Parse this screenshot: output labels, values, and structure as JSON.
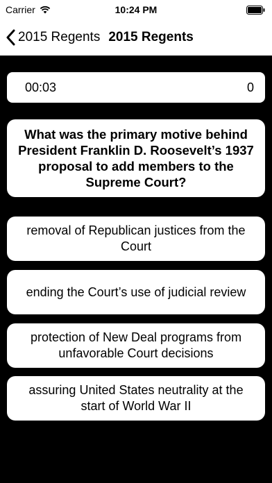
{
  "status_bar": {
    "carrier": "Carrier",
    "time": "10:24 PM"
  },
  "nav": {
    "back_label": "2015 Regents",
    "title": "2015 Regents"
  },
  "timer": {
    "elapsed": "00:03",
    "score": "0"
  },
  "question": {
    "text": "What was the primary motive behind President Franklin D. Roosevelt’s 1937 proposal to add members to the Supreme Court?"
  },
  "answers": [
    {
      "label": "removal of Republican justices from the Court"
    },
    {
      "label": "ending the Court’s use of judicial review"
    },
    {
      "label": "protection of New Deal programs from unfavorable Court decisions"
    },
    {
      "label": "assuring United States neutrality at the start of World War II"
    }
  ],
  "icons": {
    "wifi": "wifi-icon",
    "battery": "battery-icon",
    "back": "chevron-left-icon"
  },
  "colors": {
    "background": "#000000",
    "card": "#ffffff",
    "text": "#000000"
  }
}
